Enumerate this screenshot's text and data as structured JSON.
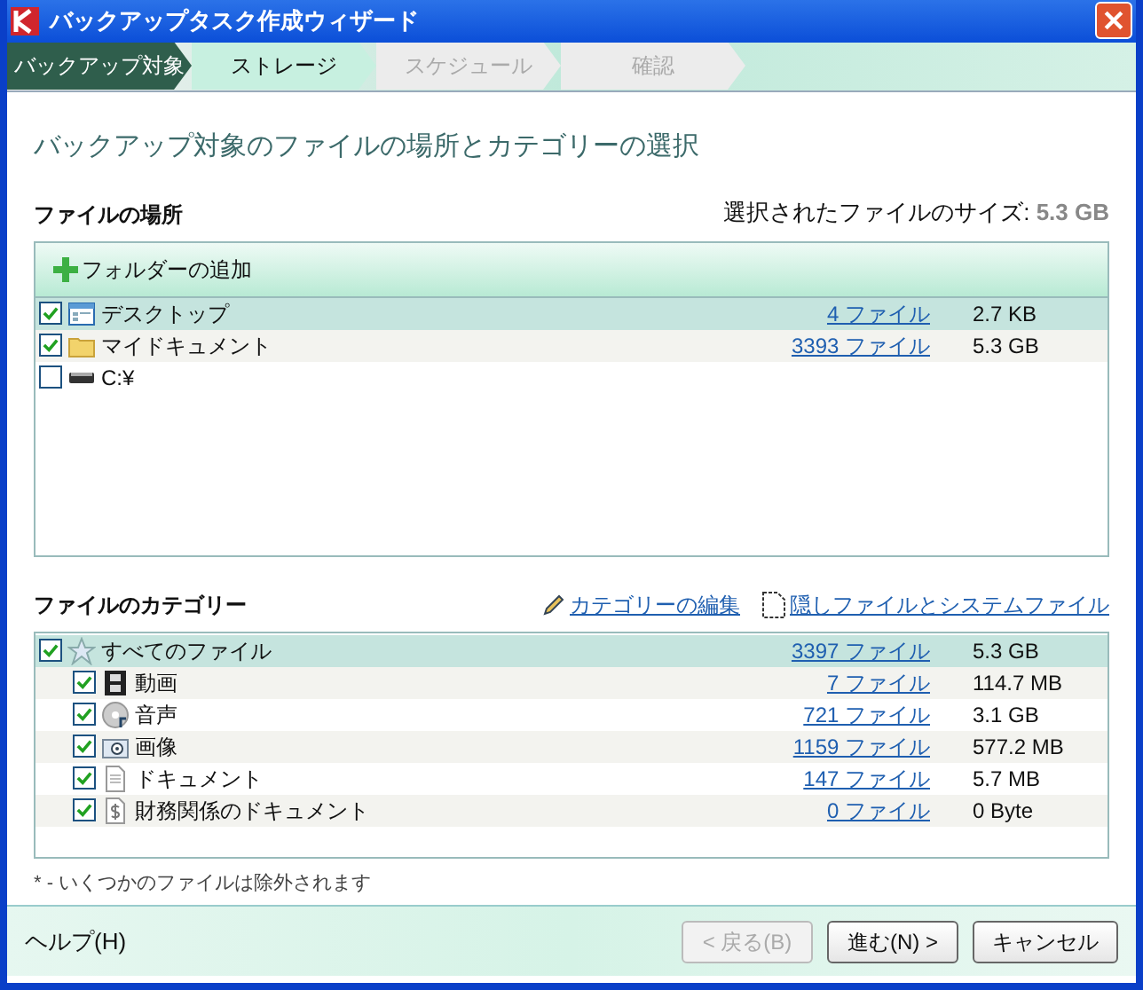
{
  "window": {
    "title": "バックアップタスク作成ウィザード"
  },
  "steps": [
    {
      "label": "バックアップ対象",
      "selected": true,
      "disabled": false
    },
    {
      "label": "ストレージ",
      "selected": false,
      "disabled": false
    },
    {
      "label": "スケジュール",
      "selected": false,
      "disabled": true
    },
    {
      "label": "確認",
      "selected": false,
      "disabled": true
    }
  ],
  "heading": "バックアップ対象のファイルの場所とカテゴリーの選択",
  "locations": {
    "title": "ファイルの場所",
    "size_label": "選択されたファイルのサイズ:",
    "size_value": "5.3 GB",
    "add_button": "フォルダーの追加",
    "rows": [
      {
        "kind": "desktop",
        "name": "デスクトップ",
        "checked": true,
        "selected": true,
        "files": "4 ファイル",
        "size": "2.7 KB"
      },
      {
        "kind": "folder",
        "name": "マイドキュメント",
        "checked": true,
        "selected": false,
        "files": "3393 ファイル",
        "size": "5.3 GB"
      },
      {
        "kind": "drive",
        "name": "C:¥",
        "checked": false,
        "selected": false
      }
    ]
  },
  "categories": {
    "title": "ファイルのカテゴリー",
    "edit_link": "カテゴリーの編集",
    "hidden_link": "隠しファイルとシステムファイル",
    "rows": [
      {
        "kind": "all",
        "name": "すべてのファイル",
        "checked": true,
        "selected": true,
        "files": "3397 ファイル",
        "size": "5.3 GB",
        "children": [
          {
            "kind": "video",
            "name": "動画",
            "checked": true,
            "selected": false,
            "files": "7 ファイル",
            "size": "114.7 MB"
          },
          {
            "kind": "audio",
            "name": "音声",
            "checked": true,
            "selected": false,
            "files": "721 ファイル",
            "size": "3.1 GB"
          },
          {
            "kind": "image",
            "name": "画像",
            "checked": true,
            "selected": false,
            "files": "1159 ファイル",
            "size": "577.2 MB"
          },
          {
            "kind": "document",
            "name": "ドキュメント",
            "checked": true,
            "selected": false,
            "files": "147 ファイル",
            "size": "5.7 MB"
          },
          {
            "kind": "finance",
            "name": "財務関係のドキュメント",
            "checked": true,
            "selected": false,
            "files": "0 ファイル",
            "size": "0 Byte"
          }
        ]
      }
    ]
  },
  "footnote": "* - いくつかのファイルは除外されます",
  "help": "ヘルプ(H)",
  "buttons": [
    {
      "label": "< 戻る(B)",
      "disabled": true
    },
    {
      "label": "進む(N) >",
      "disabled": false
    },
    {
      "label": "キャンセル",
      "disabled": false
    }
  ]
}
